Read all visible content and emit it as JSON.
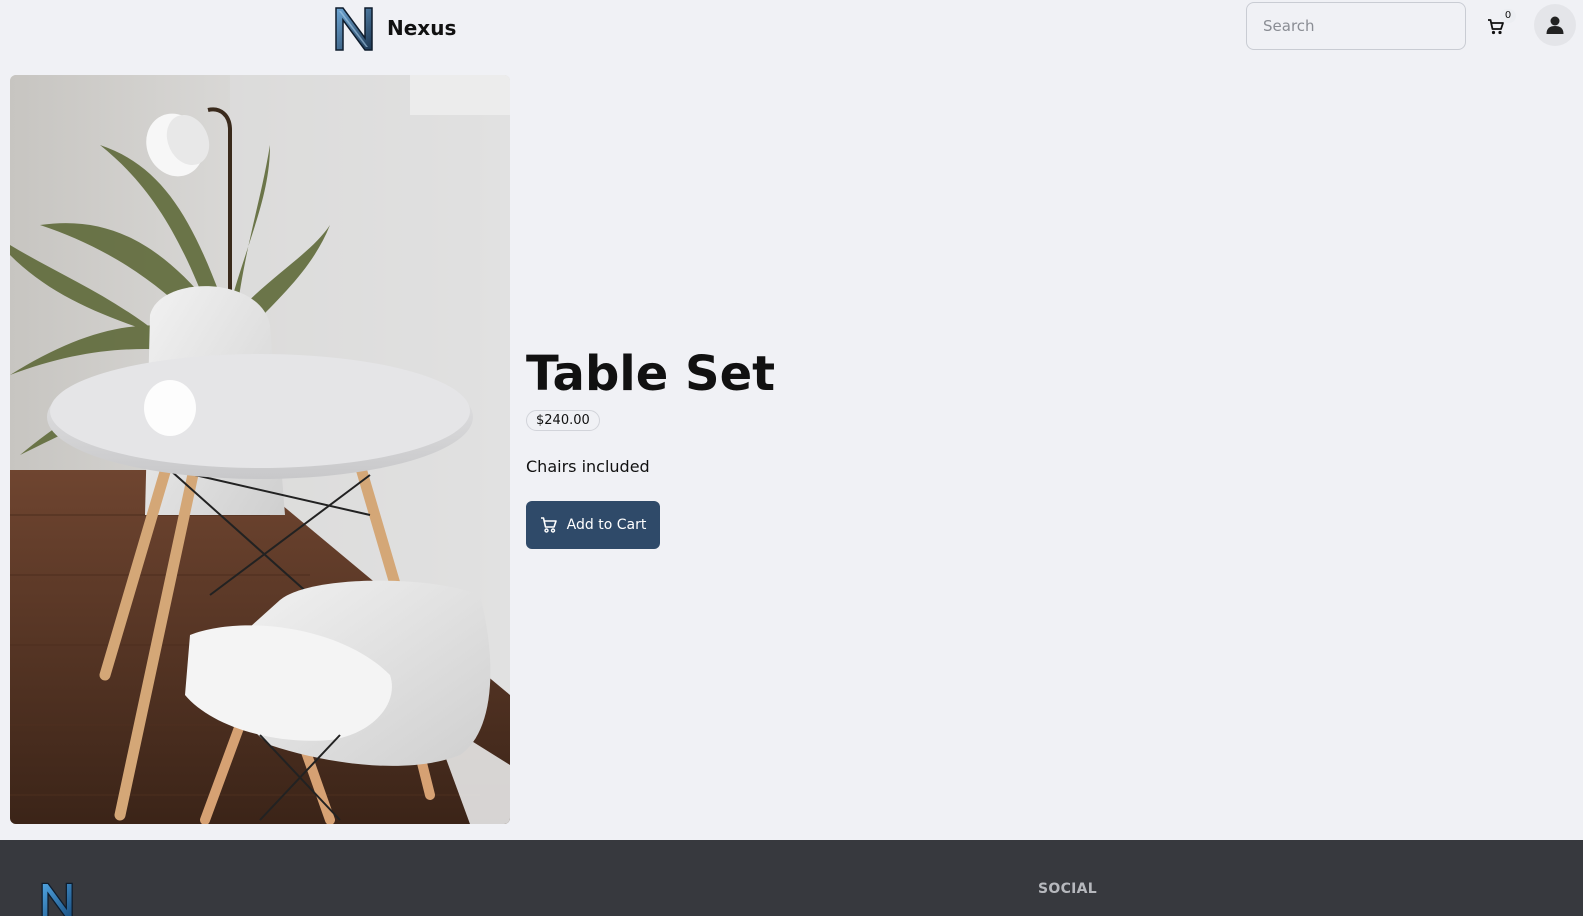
{
  "header": {
    "brand_name": "Nexus",
    "search_placeholder": "Search",
    "cart_count": "0"
  },
  "product": {
    "title": "Table Set",
    "price": "$240.00",
    "description": "Chairs included",
    "add_to_cart_label": "Add to Cart"
  },
  "footer": {
    "social_heading": "SOCIAL"
  },
  "colors": {
    "background": "#f0f1f5",
    "primary_button": "#2f4a69",
    "footer": "#37393e"
  },
  "icons": {
    "brand": "nexus-logo",
    "cart": "cart-icon",
    "user": "user-icon"
  }
}
